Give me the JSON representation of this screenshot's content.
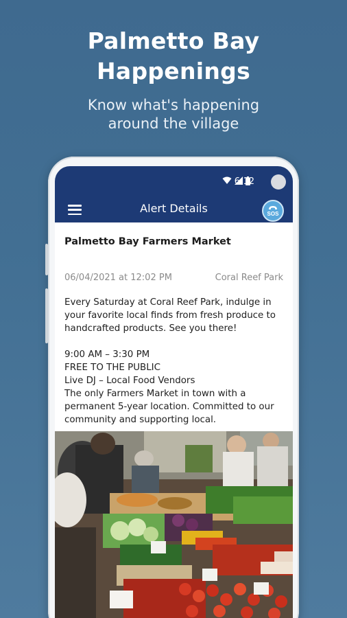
{
  "promo": {
    "title_line1": "Palmetto Bay",
    "title_line2": "Happenings",
    "subtitle_line1": "Know what's happening",
    "subtitle_line2": "around the village"
  },
  "statusbar": {
    "time": "6:12"
  },
  "appbar": {
    "title": "Alert Details",
    "sos_label": "SOS"
  },
  "alert": {
    "title": "Palmetto Bay Farmers Market",
    "datetime": "06/04/2021 at 12:02 PM",
    "location": "Coral Reef Park",
    "description": "Every Saturday at Coral Reef Park, indulge in your favorite local finds from fresh produce to handcrafted products. See you there!",
    "hours": "9:00 AM – 3:30 PM",
    "admission": "FREE TO THE PUBLIC",
    "extras": "Live DJ – Local Food Vendors",
    "closing": "The only Farmers Market in town with a permanent 5-year location. Committed to our community and supporting local."
  },
  "colors": {
    "background": "#426f93",
    "appbar": "#1d3a75",
    "sos": "#5aa9dd"
  },
  "icons": {
    "menu": "hamburger-icon",
    "wifi": "wifi-icon",
    "signal": "signal-icon",
    "battery": "battery-icon",
    "sos": "sos-phone-icon"
  }
}
